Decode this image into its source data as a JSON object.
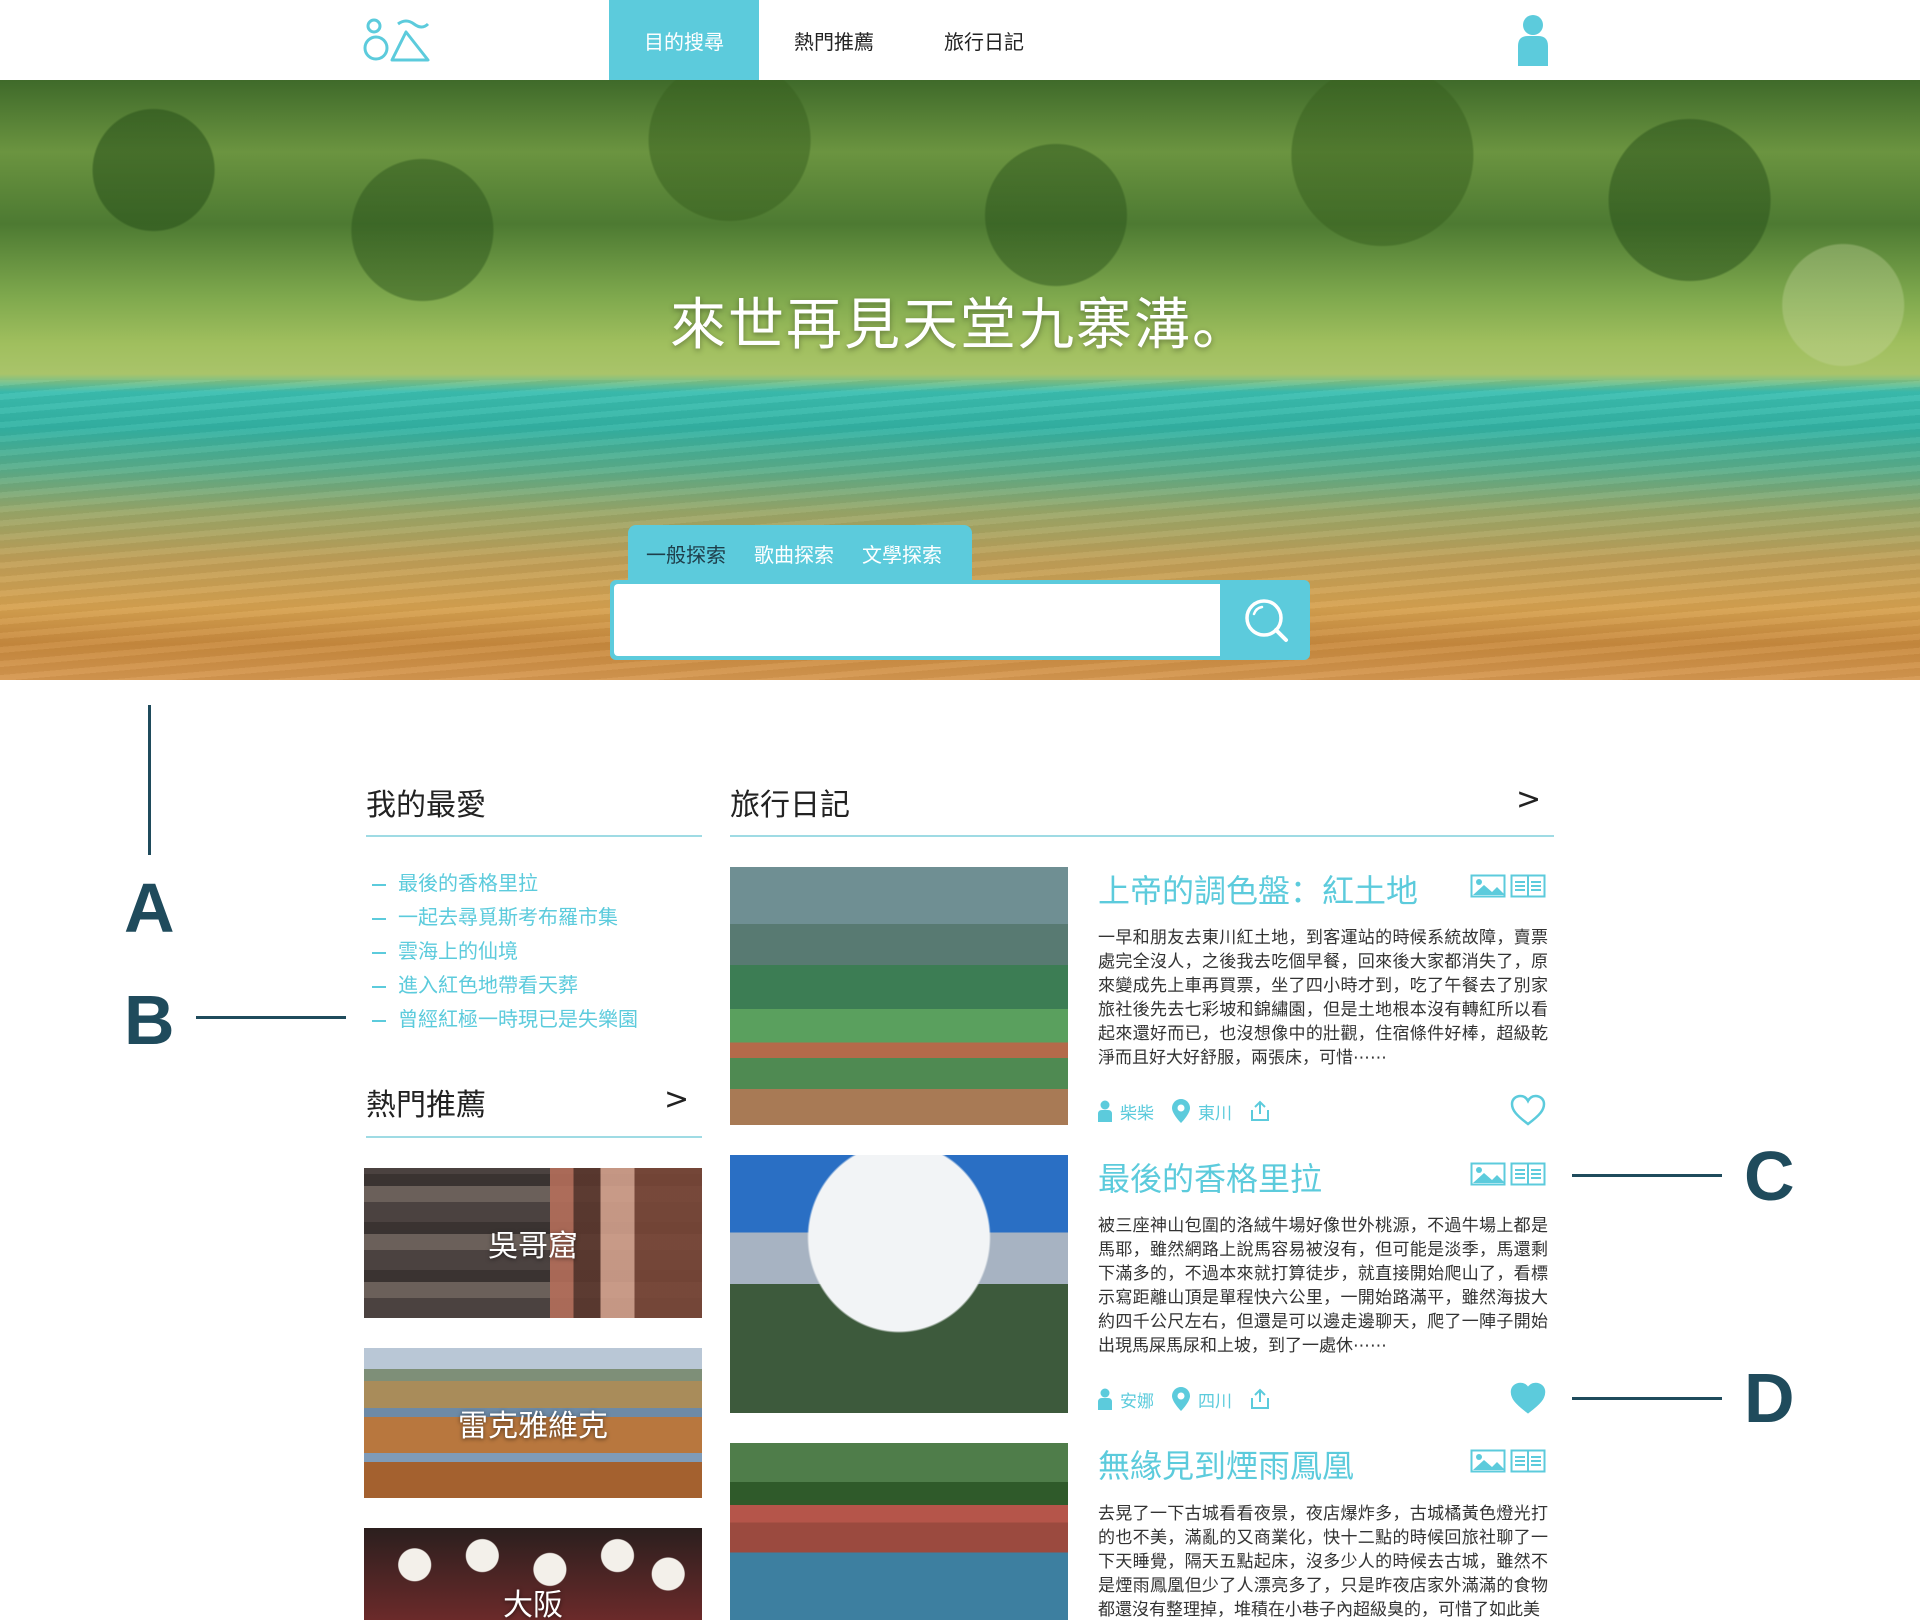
{
  "nav": {
    "tabs": [
      {
        "label": "目的搜尋",
        "active": true
      },
      {
        "label": "熱門推薦",
        "active": false
      },
      {
        "label": "旅行日記",
        "active": false
      }
    ]
  },
  "hero": {
    "title": "來世再見天堂九寨溝。",
    "search": {
      "tabs": [
        "一般探索",
        "歌曲探索",
        "文學探索"
      ],
      "active_tab": "一般探索",
      "value": "",
      "placeholder": ""
    }
  },
  "annotations": {
    "a": "A",
    "b": "B",
    "c": "C",
    "d": "D"
  },
  "favorites": {
    "title": "我的最愛",
    "items": [
      "最後的香格里拉",
      "一起去尋覓斯考布羅市集",
      "雲海上的仙境",
      "進入紅色地帶看天葬",
      "曾經紅極一時現已是失樂園"
    ]
  },
  "recommend": {
    "title": "熱門推薦",
    "more": ">",
    "items": [
      "吳哥窟",
      "雷克雅維克",
      "大阪"
    ]
  },
  "diary": {
    "title": "旅行日記",
    "more": ">",
    "entries": [
      {
        "title": "上帝的調色盤：紅土地",
        "body": "一早和朋友去東川紅土地，到客運站的時候系統故障，賣票處完全沒人，之後我去吃個早餐，回來後大家都消失了，原來變成先上車再買票，坐了四小時才到，吃了午餐去了別家旅社後先去七彩坡和錦繡園，但是土地根本沒有轉紅所以看起來還好而已，也沒想像中的壯觀，住宿條件好棒，超級乾淨而且好大好舒服，兩張床，可惜⋯⋯",
        "author": "柴柴",
        "location": "東川",
        "liked": false
      },
      {
        "title": "最後的香格里拉",
        "body": "被三座神山包圍的洛絨牛場好像世外桃源，不過牛場上都是馬耶，雖然網路上說馬容易被沒有，但可能是淡季，馬還剩下滿多的，不過本來就打算徒步，就直接開始爬山了，看標示寫距離山頂是單程快六公里，一開始路滿平，雖然海拔大約四千公尺左右，但還是可以邊走邊聊天，爬了一陣子開始出現馬屎馬尿和上坡，到了一處休⋯⋯",
        "author": "安娜",
        "location": "四川",
        "liked": true
      },
      {
        "title": "無緣見到煙雨鳳凰",
        "body": "去晃了一下古城看看夜景，夜店爆炸多，古城橘黃色燈光打的也不美，滿亂的又商業化，快十二點的時候回旅社聊了一下天睡覺，隔天五點起床，沒多少人的時候去古城，雖然不是煙雨鳳凰但少了人漂亮多了，只是昨夜店家外滿滿的食物都還沒有整理掉，堆積在小巷子內超級臭的，可惜了如此美"
      }
    ]
  },
  "colors": {
    "accent": "#5ccbdc",
    "annotation": "#1f4b5c"
  }
}
